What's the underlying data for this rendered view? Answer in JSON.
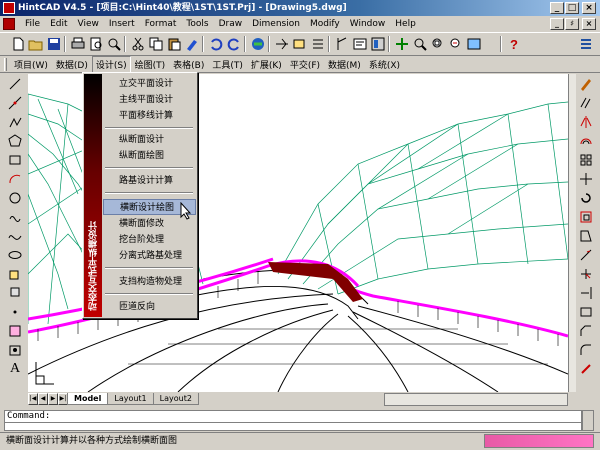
{
  "window": {
    "title": "HintCAD V4.5 - [项目:C:\\Hint40\\教程\\1ST\\1ST.Prj] - [Drawing5.dwg]",
    "controls": [
      "_",
      "□",
      "×"
    ],
    "mdi_controls": [
      "_",
      "♯",
      "×"
    ]
  },
  "menubar": {
    "items": [
      "File",
      "Edit",
      "View",
      "Insert",
      "Format",
      "Tools",
      "Draw",
      "Dimension",
      "Modify",
      "Window",
      "Help"
    ]
  },
  "toolbar": {
    "icons": [
      "new-icon",
      "open-icon",
      "save-icon",
      "print-icon",
      "preview-icon",
      "plot-icon",
      "cut-icon",
      "copy-icon",
      "paste-icon",
      "match-properties-icon",
      "undo-icon",
      "redo-icon",
      "hyperlink-icon",
      "snap-icon",
      "layer-icon",
      "list-icon",
      "ortho-icon",
      "properties-icon",
      "design-center-icon",
      "pan-icon",
      "zoom-realtime-icon",
      "zoom-window-icon",
      "zoom-previous-icon",
      "aerial-view-icon",
      "help-icon"
    ]
  },
  "cn_menubar": {
    "items": [
      "项目(W)",
      "数据(D)",
      "设计(S)",
      "绘图(T)",
      "表格(B)",
      "工具(T)",
      "扩展(K)",
      "平交(F)",
      "数据(M)",
      "系统(X)"
    ]
  },
  "dropdown": {
    "side_caption": "动态交互式平纵横设计",
    "items": [
      "立交平面设计",
      "主线平面设计",
      "平面移线计算",
      "纵断面设计",
      "纵断面绘图",
      "路基设计计算",
      "横断设计绘图",
      "横断面修改",
      "挖台阶处理",
      "分离式路基处理",
      "支挡构造物处理",
      "匝道反向"
    ],
    "selected": "横断设计绘图"
  },
  "layout_tabs": [
    "Model",
    "Layout1",
    "Layout2"
  ],
  "active_tab": "Model",
  "command": {
    "prompt": "Command:",
    "value": ""
  },
  "status": {
    "text": "横断面设计计算并以各种方式绘制横断面图"
  },
  "colors": {
    "title_start": "#0a246a",
    "terrain": "#009966",
    "guardrail": "#ff00ff",
    "road": "#000000",
    "menu_side": "#c00000",
    "selection": "#a6b8d8",
    "status_box": "#ff74c4"
  }
}
